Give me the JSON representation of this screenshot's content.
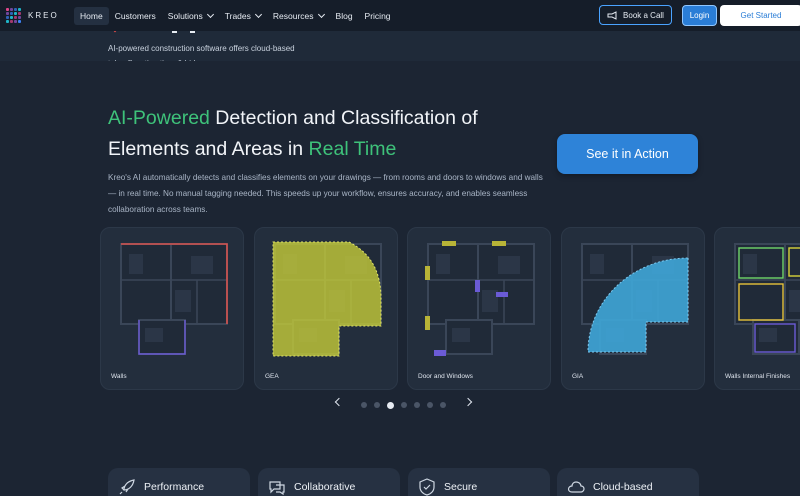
{
  "brand": {
    "name": "KREO"
  },
  "nav": {
    "items": [
      {
        "label": "Home",
        "active": true,
        "dropdown": false
      },
      {
        "label": "Customers",
        "active": false,
        "dropdown": false
      },
      {
        "label": "Solutions",
        "active": false,
        "dropdown": true
      },
      {
        "label": "Trades",
        "active": false,
        "dropdown": true
      },
      {
        "label": "Resources",
        "active": false,
        "dropdown": true
      },
      {
        "label": "Blog",
        "active": false,
        "dropdown": false
      },
      {
        "label": "Pricing",
        "active": false,
        "dropdown": false
      }
    ],
    "book_call": "Book a Call",
    "login": "Login",
    "get_started": "Get Started"
  },
  "strip": {
    "text": "AI-powered construction software offers cloud-based takeoff, estimating, & bid..."
  },
  "hero": {
    "title_accent_1": "AI-Powered",
    "title_mid": " Detection and Classification of Elements and Areas in ",
    "title_accent_2": "Real Time",
    "description": "Kreo's AI automatically detects and classifies elements on your drawings — from rooms and doors to windows and walls — in real time. No manual tagging needed. This speeds up your workflow, ensures accuracy, and enables seamless collaboration across teams.",
    "cta": "See it in Action"
  },
  "carousel": {
    "cards": [
      {
        "label": "Walls",
        "highlight": "#d9534f"
      },
      {
        "label": "GEA",
        "highlight": "#c5cc3a"
      },
      {
        "label": "Door and Windows",
        "highlight": "#b8b437"
      },
      {
        "label": "GIA",
        "highlight": "#3fa6d8"
      },
      {
        "label": "Walls Internal Finishes",
        "highlight": "#6fd66a"
      }
    ],
    "dot_count": 7,
    "active_dot": 2
  },
  "features": [
    {
      "label": "Performance",
      "icon": "rocket-icon"
    },
    {
      "label": "Collaborative",
      "icon": "chat-icon"
    },
    {
      "label": "Secure",
      "icon": "shield-icon"
    },
    {
      "label": "Cloud-based",
      "icon": "cloud-icon"
    }
  ],
  "colors": {
    "accent_green": "#3ec27a",
    "accent_blue": "#2e83d8",
    "background": "#1c2533"
  }
}
